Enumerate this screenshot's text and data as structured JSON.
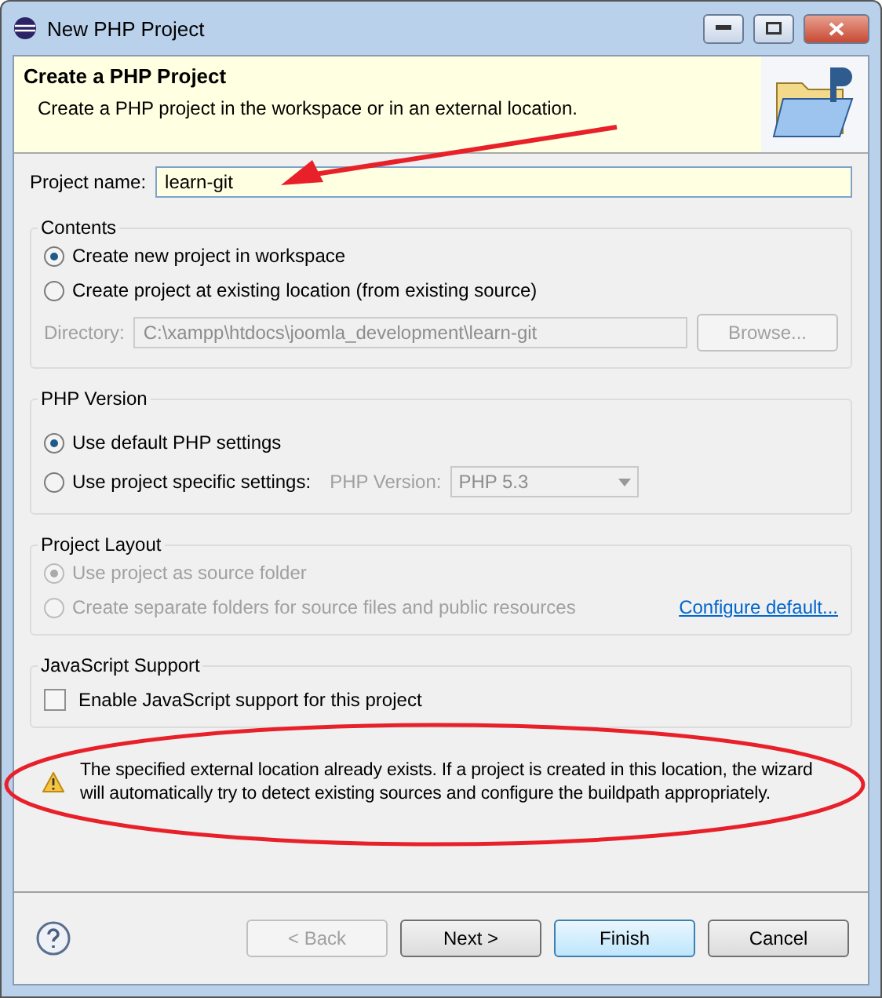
{
  "window": {
    "title": "New PHP Project"
  },
  "header": {
    "title": "Create a PHP Project",
    "description": "Create a PHP project in the workspace or in an external location."
  },
  "project_name": {
    "label": "Project name:",
    "value": "learn-git"
  },
  "contents": {
    "title": "Contents",
    "options": [
      {
        "label": "Create new project in workspace",
        "selected": true
      },
      {
        "label": "Create project at existing location (from existing source)",
        "selected": false
      }
    ],
    "directory": {
      "label": "Directory:",
      "value": "C:\\xampp\\htdocs\\joomla_development\\learn-git",
      "disabled": true
    },
    "browse": {
      "label": "Browse...",
      "disabled": true
    }
  },
  "php_version": {
    "title": "PHP Version",
    "options": [
      {
        "label": "Use default PHP settings",
        "selected": true
      },
      {
        "label": "Use project specific settings:",
        "selected": false
      }
    ],
    "version_label": "PHP Version:",
    "version_value": "PHP 5.3",
    "disabled": true
  },
  "project_layout": {
    "title": "Project Layout",
    "disabled": true,
    "options": [
      {
        "label": "Use project as source folder",
        "selected": true
      },
      {
        "label": "Create separate folders for source files and public resources",
        "selected": false
      }
    ],
    "link": "Configure default..."
  },
  "javascript": {
    "title": "JavaScript Support",
    "checkbox": {
      "label": "Enable JavaScript support for this project",
      "checked": false
    }
  },
  "warning": "The specified external location already exists. If a project is created in this location, the wizard will automatically try to detect existing sources and configure the buildpath appropriately.",
  "buttons": [
    {
      "label": "< Back",
      "disabled": true,
      "default": false
    },
    {
      "label": "Next >",
      "disabled": false,
      "default": false
    },
    {
      "label": "Finish",
      "disabled": false,
      "default": true
    },
    {
      "label": "Cancel",
      "disabled": false,
      "default": false
    }
  ]
}
